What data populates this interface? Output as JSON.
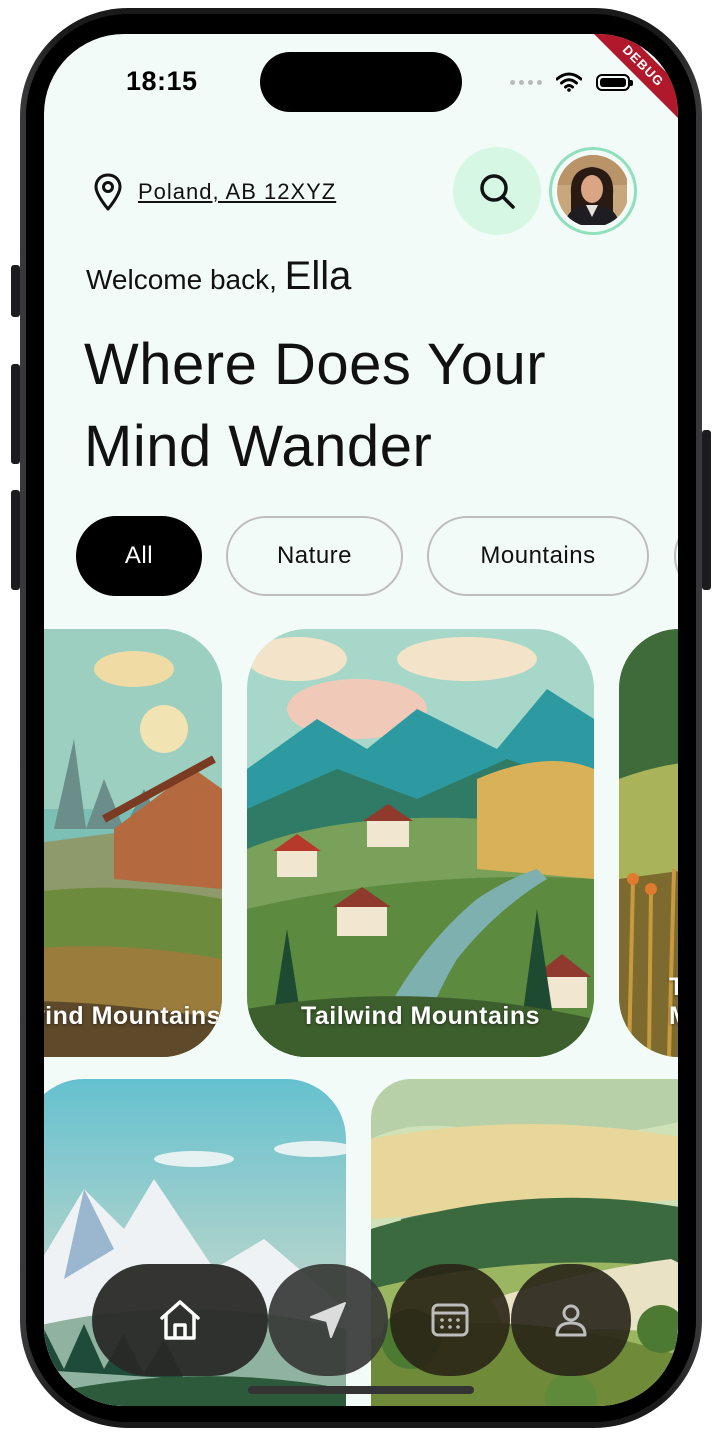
{
  "status_bar": {
    "time": "18:15",
    "debug_banner": "DEBUG"
  },
  "header": {
    "location": "Poland, AB 12XYZ",
    "location_icon": "map-pin-icon",
    "search_icon": "search-icon",
    "avatar": "user-avatar-photo"
  },
  "welcome": {
    "prefix": "Welcome back,",
    "name": "Ella"
  },
  "headline": "Where Does Your Mind Wander",
  "chips": [
    {
      "label": "All",
      "active": true
    },
    {
      "label": "Nature",
      "active": false
    },
    {
      "label": "Mountains",
      "active": false
    }
  ],
  "cards_row1": [
    {
      "title": "Tailwind Mountains"
    },
    {
      "title": "Tailwind Mountains"
    },
    {
      "title": "Tailwind Mountains"
    }
  ],
  "bottom_nav": [
    {
      "icon": "home-icon",
      "active": true
    },
    {
      "icon": "navigation-arrow-icon",
      "active": false
    },
    {
      "icon": "calendar-icon",
      "active": false
    },
    {
      "icon": "profile-icon",
      "active": false
    }
  ],
  "colors": {
    "accent_mint": "#d6f7e4",
    "avatar_ring": "#8fe0bd",
    "screen_bg": "#f3fbf8"
  }
}
